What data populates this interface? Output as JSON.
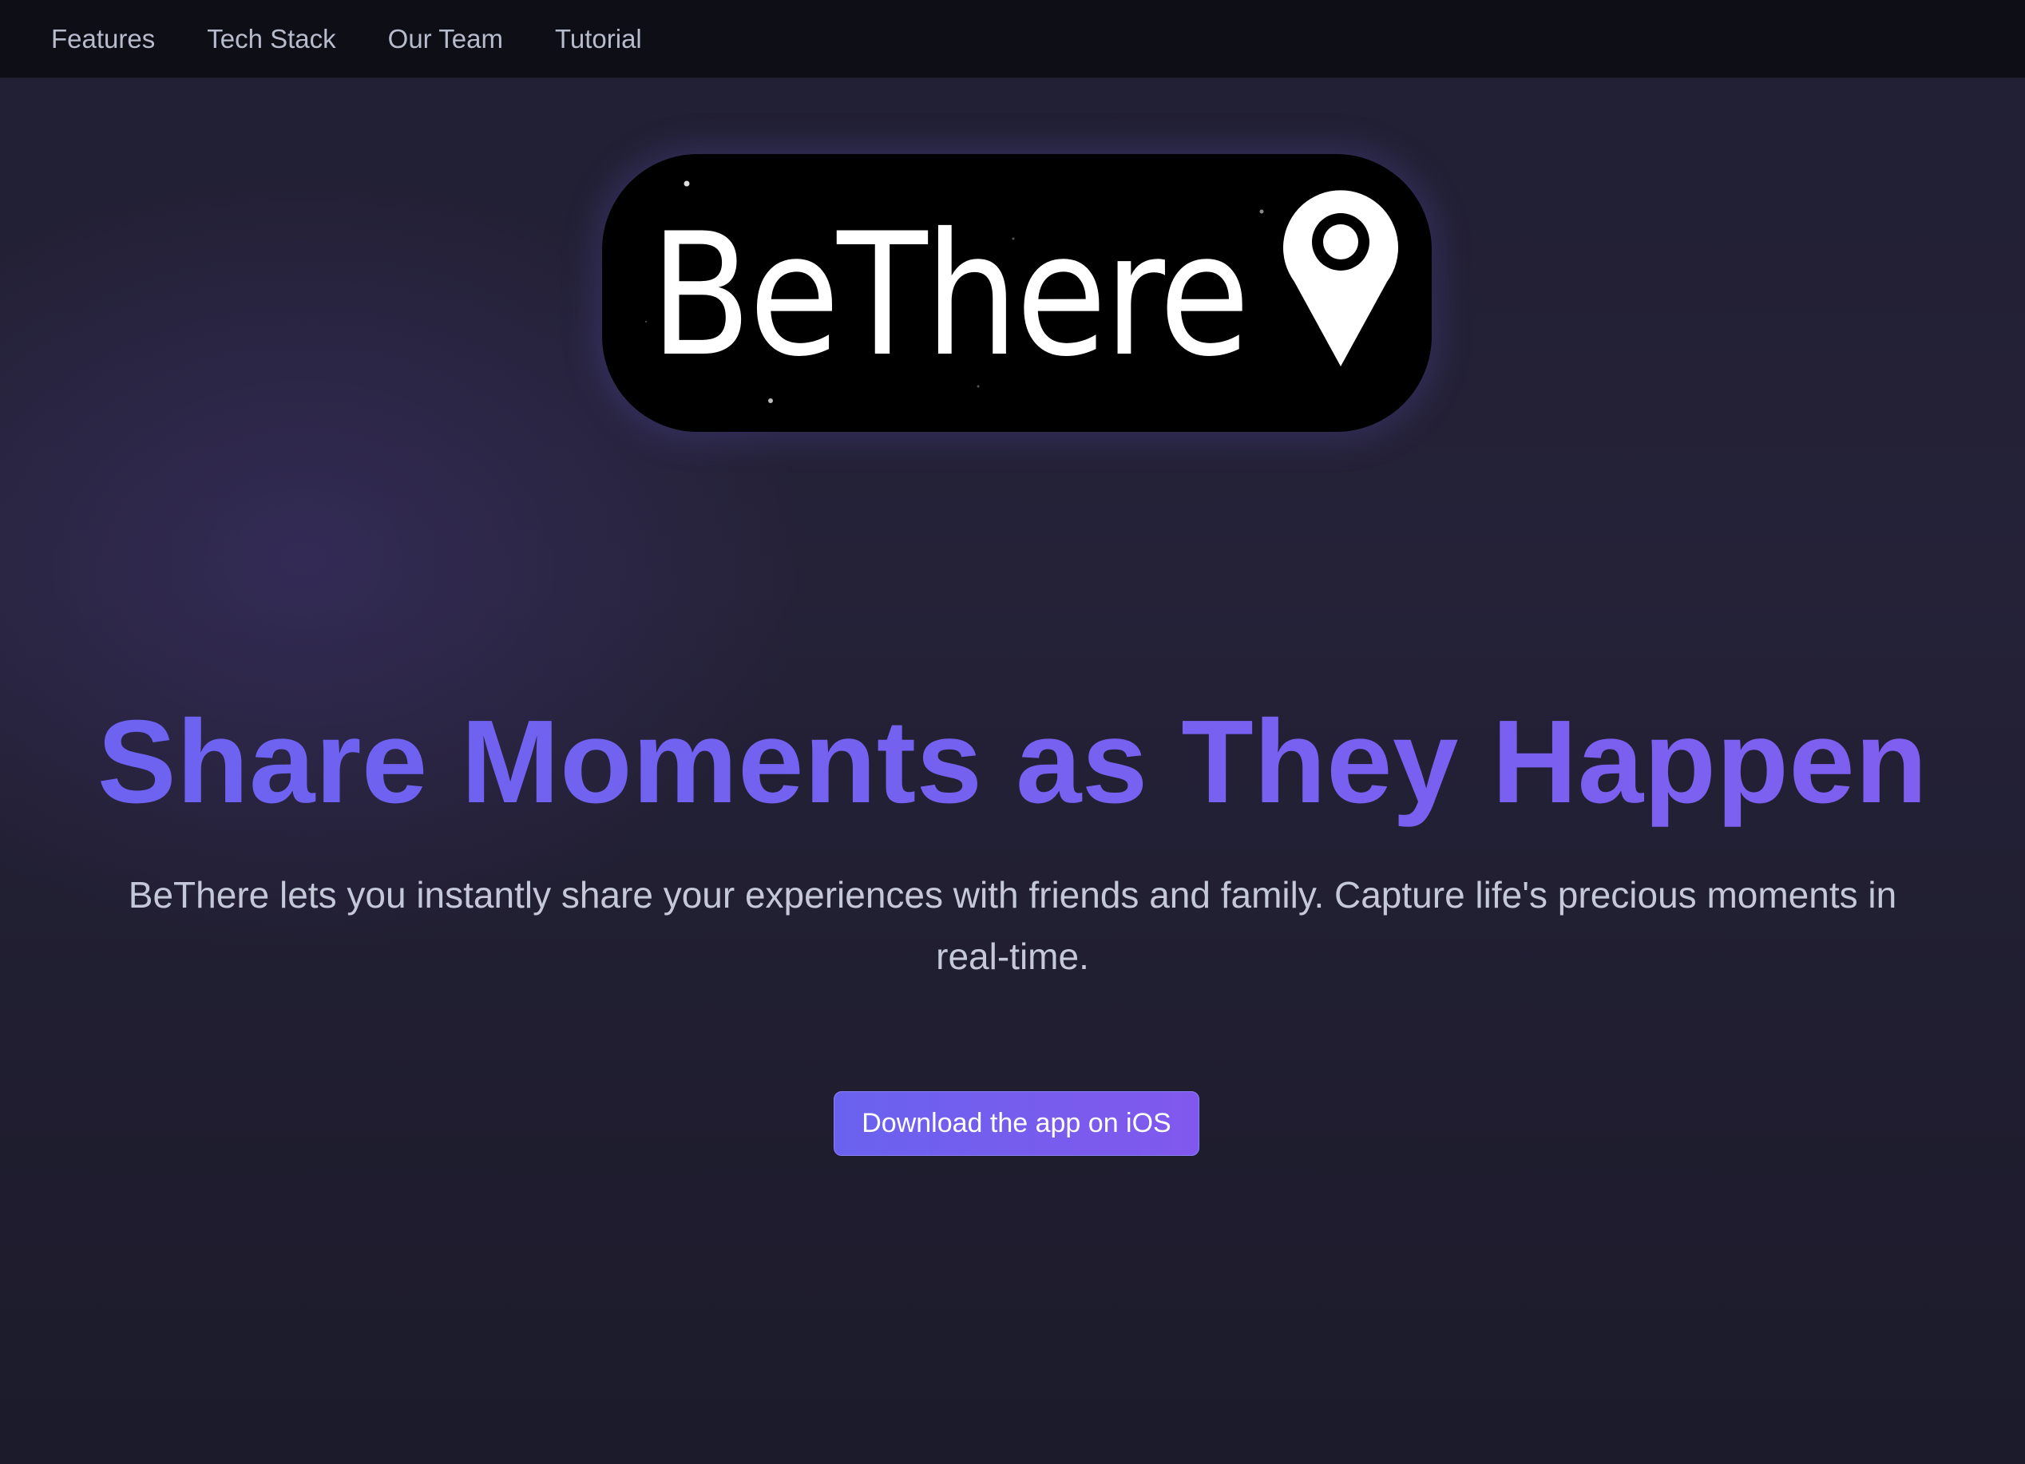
{
  "nav": {
    "items": [
      {
        "label": "Features"
      },
      {
        "label": "Tech Stack"
      },
      {
        "label": "Our Team"
      },
      {
        "label": "Tutorial"
      }
    ]
  },
  "logo": {
    "wordmark": "BeThere",
    "icon": "map-pin-icon"
  },
  "hero": {
    "title": "Share Moments as They Happen",
    "subtitle": "BeThere lets you instantly share your experiences with friends and family. Capture life's precious moments in real-time.",
    "cta_label": "Download the app on iOS"
  },
  "colors": {
    "accent": "#6c63f0",
    "accent_end": "#8158ee",
    "background": "#1e1c2e",
    "nav_background": "#0e0e16"
  }
}
